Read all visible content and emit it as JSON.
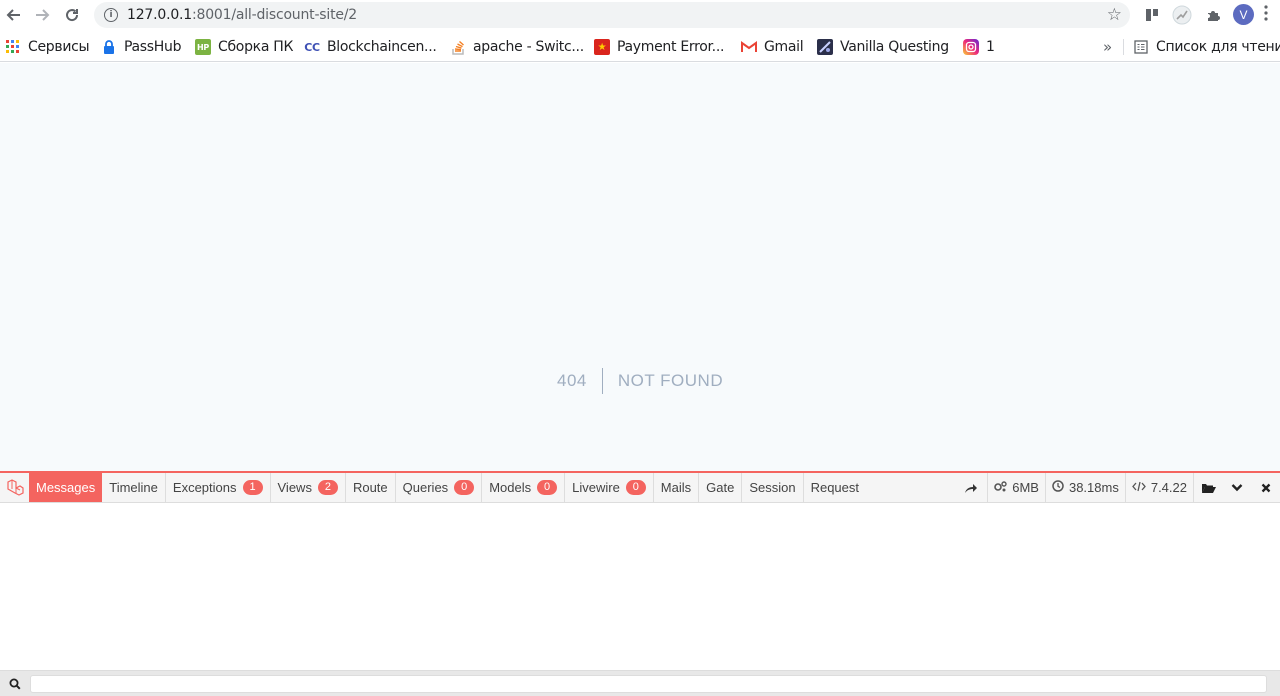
{
  "browser": {
    "url_host": "127.0.0.1",
    "url_path": ":8001/all-discount-site/2",
    "avatar_letter": "V"
  },
  "bookmarks": {
    "items": [
      {
        "label": "Сервисы",
        "icon": "apps-grid-icon"
      },
      {
        "label": "PassHub",
        "icon": "lock-icon"
      },
      {
        "label": "Сборка ПК",
        "icon": "hp-icon"
      },
      {
        "label": "Blockchaincen...",
        "icon": "blockchain-icon"
      },
      {
        "label": "apache - Switc...",
        "icon": "stackoverflow-icon"
      },
      {
        "label": "Payment Error...",
        "icon": "flag-icon"
      },
      {
        "label": "Gmail",
        "icon": "gmail-icon"
      },
      {
        "label": "Vanilla Questing",
        "icon": "game-icon"
      },
      {
        "label": "1",
        "icon": "instagram-icon"
      }
    ],
    "overflow": "»",
    "reading_list": "Список для чтения"
  },
  "page": {
    "code": "404",
    "message": "NOT FOUND"
  },
  "debugbar": {
    "tabs": [
      {
        "label": "Messages",
        "badge": null,
        "active": true
      },
      {
        "label": "Timeline",
        "badge": null,
        "active": false
      },
      {
        "label": "Exceptions",
        "badge": "1",
        "active": false
      },
      {
        "label": "Views",
        "badge": "2",
        "active": false
      },
      {
        "label": "Route",
        "badge": null,
        "active": false
      },
      {
        "label": "Queries",
        "badge": "0",
        "active": false
      },
      {
        "label": "Models",
        "badge": "0",
        "active": false
      },
      {
        "label": "Livewire",
        "badge": "0",
        "active": false
      },
      {
        "label": "Mails",
        "badge": null,
        "active": false
      },
      {
        "label": "Gate",
        "badge": null,
        "active": false
      },
      {
        "label": "Session",
        "badge": null,
        "active": false
      },
      {
        "label": "Request",
        "badge": null,
        "active": false
      }
    ],
    "memory": "6MB",
    "time": "38.18ms",
    "php_version": "7.4.22",
    "accent_color": "#f4645f"
  }
}
